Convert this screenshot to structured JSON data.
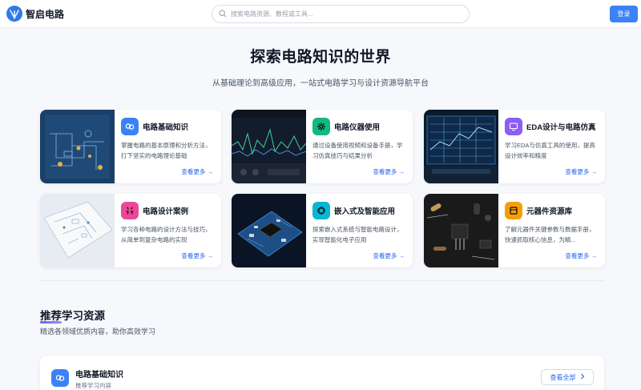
{
  "header": {
    "logo_text": "智启电路",
    "search_placeholder": "搜索电路资源、教程或工具...",
    "login_label": "登录"
  },
  "hero": {
    "title": "探索电路知识的世界",
    "subtitle": "从基础理论到高级应用，一站式电路学习与设计资源导航平台"
  },
  "cards": [
    {
      "title": "电路基础知识",
      "desc": "掌握电路的基本原理和分析方法，打下坚实的电路理论基础",
      "more": "查看更多 →",
      "icon": "link-icon",
      "color": "#3b82f6"
    },
    {
      "title": "电路仪器使用",
      "desc": "通过设备使用视频和设备手册，学习仿真技巧与结果分析",
      "more": "查看更多 →",
      "icon": "gear-icon",
      "color": "#10b981"
    },
    {
      "title": "EDA设计与电路仿真",
      "desc": "学习EDA与仿真工具的使用，提高设计效率和精度",
      "more": "查看更多 →",
      "icon": "monitor-icon",
      "color": "#8b5cf6"
    },
    {
      "title": "电路设计案例",
      "desc": "学习各种电路的设计方法与技巧，从简单到复杂电路的实现",
      "more": "查看更多 →",
      "icon": "sparkle-icon",
      "color": "#ec4899"
    },
    {
      "title": "嵌入式及智能应用",
      "desc": "探索嵌入式系统与智能电路设计，实现智能化电子应用",
      "more": "查看更多 →",
      "icon": "chip-icon",
      "color": "#06b6d4"
    },
    {
      "title": "元器件资源库",
      "desc": "了解元器件关键参数与数据手册，快速抓取核心信息，为精...",
      "more": "查看更多 →",
      "icon": "box-icon",
      "color": "#f59e0b"
    }
  ],
  "section": {
    "title": "推荐学习资源",
    "subtitle": "精选各领域优质内容，助你高效学习"
  },
  "resource": {
    "title": "电路基础知识",
    "subtitle": "推荐学习内容",
    "view_all": "查看全部"
  }
}
